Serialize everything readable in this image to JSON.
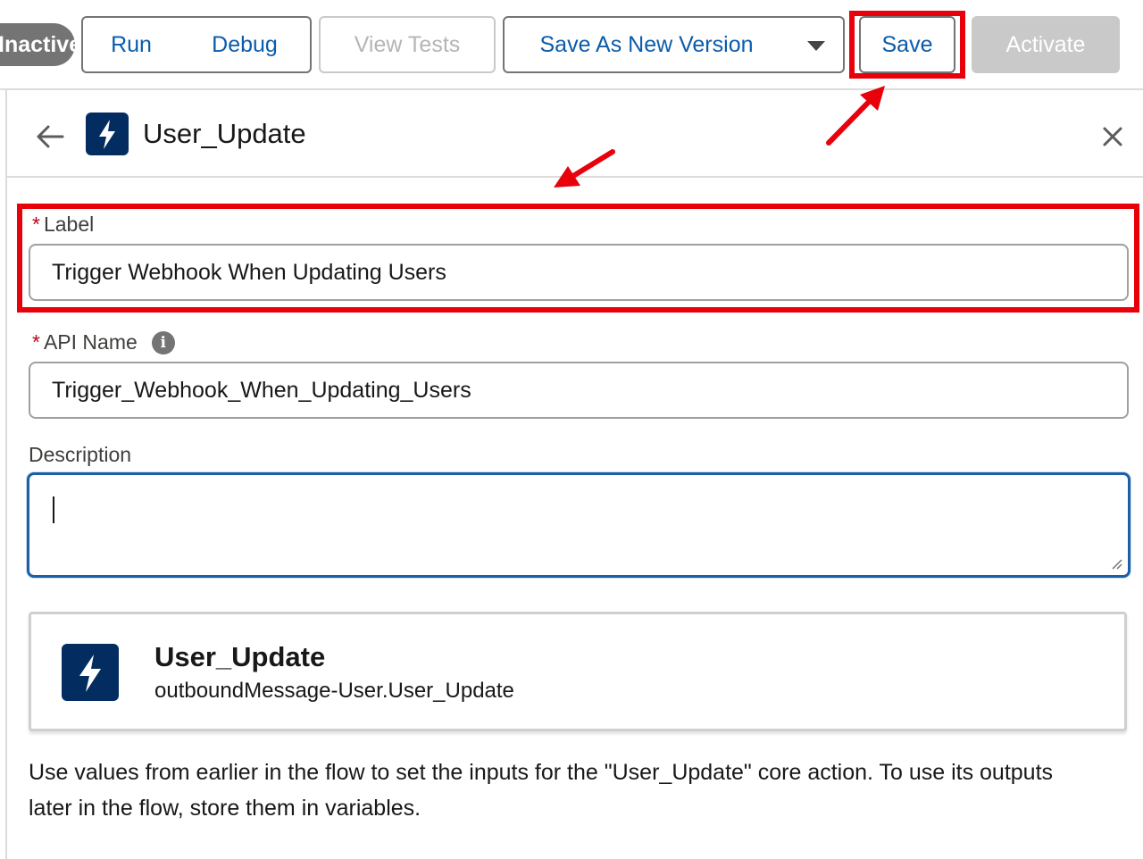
{
  "toolbar": {
    "status_pill": "Inactive",
    "run_label": "Run",
    "debug_label": "Debug",
    "view_tests_label": "View Tests",
    "save_as_new_version_label": "Save As New Version",
    "save_label": "Save",
    "activate_label": "Activate"
  },
  "panel": {
    "title": "User_Update",
    "label_field": {
      "label": "Label",
      "value": "Trigger Webhook When Updating Users"
    },
    "api_name_field": {
      "label": "API Name",
      "value": "Trigger_Webhook_When_Updating_Users"
    },
    "description_field": {
      "label": "Description",
      "value": ""
    },
    "action_card": {
      "title": "User_Update",
      "subtitle": "outboundMessage-User.User_Update"
    },
    "help_text": "Use values from earlier in the flow to set the inputs for the \"User_Update\" core action. To use its outputs later in the flow, store them in variables."
  },
  "icons": {
    "back": "arrow-left-icon",
    "header": "lightning-bolt-icon",
    "close": "close-icon",
    "info": "info-icon",
    "dropdown": "chevron-down-icon",
    "card": "lightning-bolt-icon"
  },
  "colors": {
    "accent": "#0b5cab",
    "icon_bg": "#032d60",
    "annotation": "#e8000b",
    "focus_border": "#1b5fa6"
  }
}
